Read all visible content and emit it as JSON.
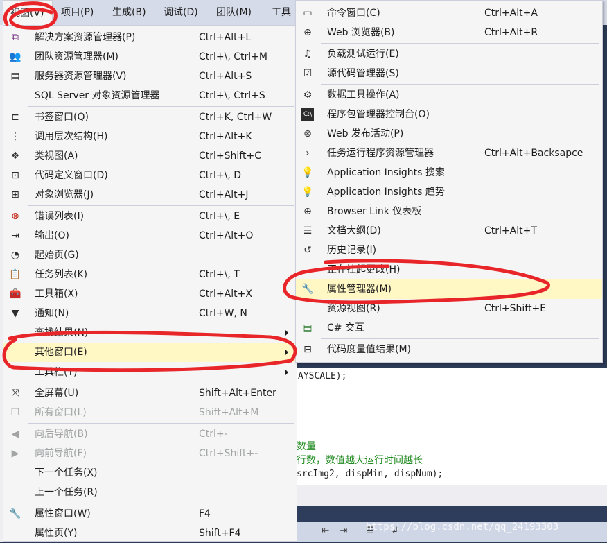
{
  "menubar": {
    "items": [
      {
        "label": "视图(V)"
      },
      {
        "label": "项目(P)"
      },
      {
        "label": "生成(B)"
      },
      {
        "label": "调试(D)"
      },
      {
        "label": "团队(M)"
      },
      {
        "label": "工具"
      }
    ]
  },
  "view_menu": {
    "items": [
      {
        "label": "解决方案资源管理器(P)",
        "shortcut": "Ctrl+Alt+L",
        "icon": "solution-explorer-icon"
      },
      {
        "label": "团队资源管理器(M)",
        "shortcut": "Ctrl+\\, Ctrl+M",
        "icon": "team-explorer-icon"
      },
      {
        "label": "服务器资源管理器(V)",
        "shortcut": "Ctrl+Alt+S",
        "icon": "server-explorer-icon"
      },
      {
        "label": "SQL Server 对象资源管理器",
        "shortcut": "Ctrl+\\, Ctrl+S",
        "icon": ""
      },
      {
        "label": "书签窗口(Q)",
        "shortcut": "Ctrl+K, Ctrl+W",
        "icon": "bookmark-icon"
      },
      {
        "label": "调用层次结构(H)",
        "shortcut": "Ctrl+Alt+K",
        "icon": "call-hierarchy-icon"
      },
      {
        "label": "类视图(A)",
        "shortcut": "Ctrl+Shift+C",
        "icon": "class-view-icon"
      },
      {
        "label": "代码定义窗口(D)",
        "shortcut": "Ctrl+\\, D",
        "icon": "code-definition-icon"
      },
      {
        "label": "对象浏览器(J)",
        "shortcut": "Ctrl+Alt+J",
        "icon": "object-browser-icon"
      },
      {
        "label": "错误列表(I)",
        "shortcut": "Ctrl+\\, E",
        "icon": "error-list-icon"
      },
      {
        "label": "输出(O)",
        "shortcut": "Ctrl+Alt+O",
        "icon": "output-icon"
      },
      {
        "label": "起始页(G)",
        "shortcut": "",
        "icon": "start-page-icon"
      },
      {
        "label": "任务列表(K)",
        "shortcut": "Ctrl+\\, T",
        "icon": "task-list-icon"
      },
      {
        "label": "工具箱(X)",
        "shortcut": "Ctrl+Alt+X",
        "icon": "toolbox-icon"
      },
      {
        "label": "通知(N)",
        "shortcut": "Ctrl+W, N",
        "icon": "notification-icon"
      },
      {
        "label": "查找结果(N)",
        "shortcut": "",
        "icon": ""
      },
      {
        "label": "其他窗口(E)",
        "shortcut": "",
        "icon": ""
      },
      {
        "label": "工具栏(T)",
        "shortcut": "",
        "icon": ""
      },
      {
        "label": "全屏幕(U)",
        "shortcut": "Shift+Alt+Enter",
        "icon": "full-screen-icon"
      },
      {
        "label": "所有窗口(L)",
        "shortcut": "Shift+Alt+M",
        "icon": "all-windows-icon"
      },
      {
        "label": "向后导航(B)",
        "shortcut": "Ctrl+-",
        "icon": "navigate-back-icon"
      },
      {
        "label": "向前导航(F)",
        "shortcut": "Ctrl+Shift+-",
        "icon": "navigate-forward-icon"
      },
      {
        "label": "下一个任务(X)",
        "shortcut": "",
        "icon": ""
      },
      {
        "label": "上一个任务(R)",
        "shortcut": "",
        "icon": ""
      },
      {
        "label": "属性窗口(W)",
        "shortcut": "F4",
        "icon": "properties-wrench-icon"
      },
      {
        "label": "属性页(Y)",
        "shortcut": "Shift+F4",
        "icon": ""
      }
    ]
  },
  "other_windows_menu": {
    "items": [
      {
        "label": "命令窗口(C)",
        "shortcut": "Ctrl+Alt+A",
        "icon": "command-window-icon"
      },
      {
        "label": "Web 浏览器(B)",
        "shortcut": "Ctrl+Alt+R",
        "icon": "web-browser-icon"
      },
      {
        "label": "负载测试运行(E)",
        "shortcut": "",
        "icon": "load-test-icon"
      },
      {
        "label": "源代码管理器(S)",
        "shortcut": "",
        "icon": "source-control-icon"
      },
      {
        "label": "数据工具操作(A)",
        "shortcut": "",
        "icon": "data-tools-icon"
      },
      {
        "label": "程序包管理器控制台(O)",
        "shortcut": "",
        "icon": "package-console-icon"
      },
      {
        "label": "Web 发布活动(P)",
        "shortcut": "",
        "icon": "web-publish-icon"
      },
      {
        "label": "任务运行程序资源管理器",
        "shortcut": "Ctrl+Alt+Backsapce",
        "icon": "task-runner-icon"
      },
      {
        "label": "Application Insights 搜索",
        "shortcut": "",
        "icon": "insights-search-icon"
      },
      {
        "label": "Application Insights 趋势",
        "shortcut": "",
        "icon": "insights-trend-icon"
      },
      {
        "label": "Browser Link 仪表板",
        "shortcut": "",
        "icon": "browser-link-icon"
      },
      {
        "label": "文档大纲(D)",
        "shortcut": "Ctrl+Alt+T",
        "icon": "document-outline-icon"
      },
      {
        "label": "历史记录(I)",
        "shortcut": "",
        "icon": "history-icon"
      },
      {
        "label": "正在挂起更改(H)",
        "shortcut": "",
        "icon": ""
      },
      {
        "label": "属性管理器(M)",
        "shortcut": "",
        "icon": "property-manager-icon"
      },
      {
        "label": "资源视图(R)",
        "shortcut": "Ctrl+Shift+E",
        "icon": ""
      },
      {
        "label": "C# 交互",
        "shortcut": "",
        "icon": "csharp-interactive-icon"
      },
      {
        "label": "代码度量值结果(M)",
        "shortcut": "",
        "icon": "code-metrics-icon"
      }
    ]
  },
  "editor": {
    "lines": [
      "AYSCALE);",
      "数量",
      "行数，数值越大运行时间越长",
      " srcImg2, dispMin, dispNum);"
    ]
  },
  "watermark": "https://blog.csdn.net/qq_24193303",
  "colors": {
    "highlight": "#fff8c5",
    "annotation": "#e8262a",
    "menu_bg": "#f5f5f5",
    "menubar_bg": "#d6dbe9"
  }
}
